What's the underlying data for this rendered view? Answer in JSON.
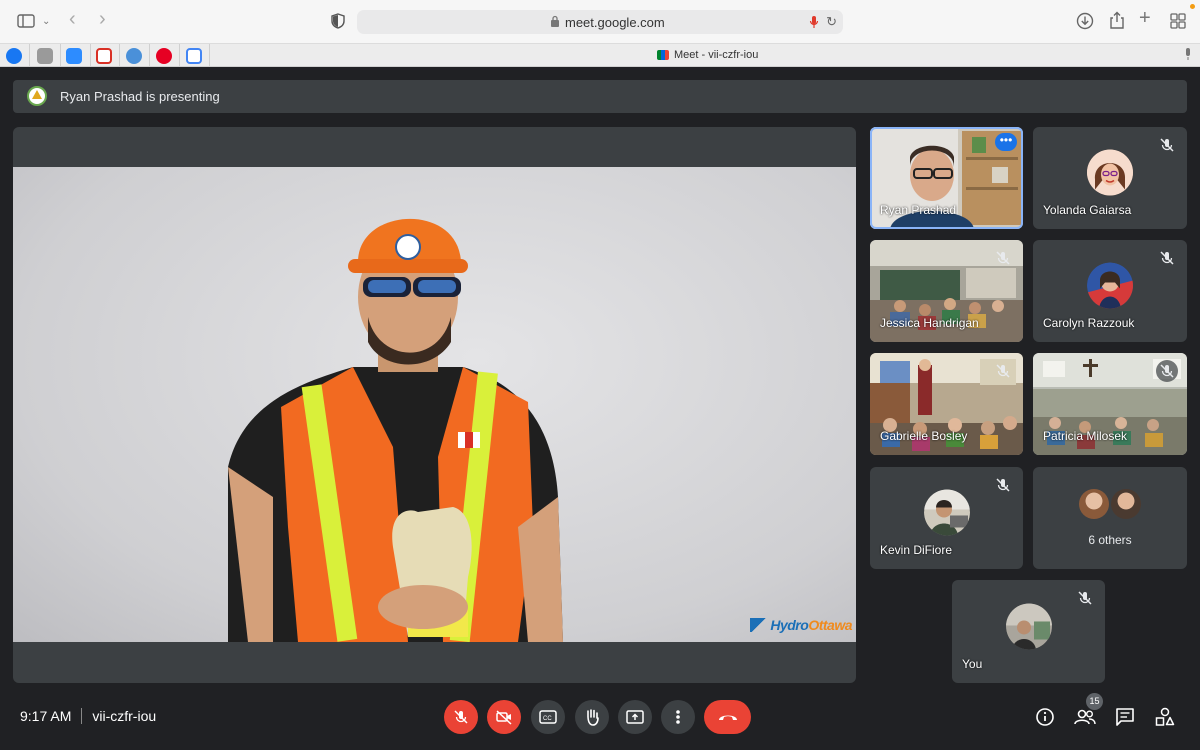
{
  "browser": {
    "url": "meet.google.com",
    "tab_title": "Meet - vii-czfr-iou"
  },
  "banner": {
    "text": "Ryan Prashad is presenting"
  },
  "stage": {
    "brand": {
      "a": "Hydro",
      "b": "Ottawa"
    }
  },
  "participants": [
    {
      "name": "Ryan Prashad",
      "muted": false
    },
    {
      "name": "Yolanda Gaiarsa",
      "muted": true
    },
    {
      "name": "Jessica Handrigan",
      "muted": true
    },
    {
      "name": "Carolyn Razzouk",
      "muted": true
    },
    {
      "name": "Gabrielle Bosley",
      "muted": true
    },
    {
      "name": "Patricia Milosek",
      "muted": true
    },
    {
      "name": "Kevin DiFiore",
      "muted": true
    },
    {
      "name": "You",
      "muted": true
    }
  ],
  "others": {
    "label": "6 others"
  },
  "footer": {
    "time": "9:17 AM",
    "meeting_code": "vii-czfr-iou",
    "people_count": "15"
  },
  "colors": {
    "accent": "#8ab4f8",
    "danger": "#ea4335",
    "surface": "#3c4043",
    "background": "#202124"
  }
}
